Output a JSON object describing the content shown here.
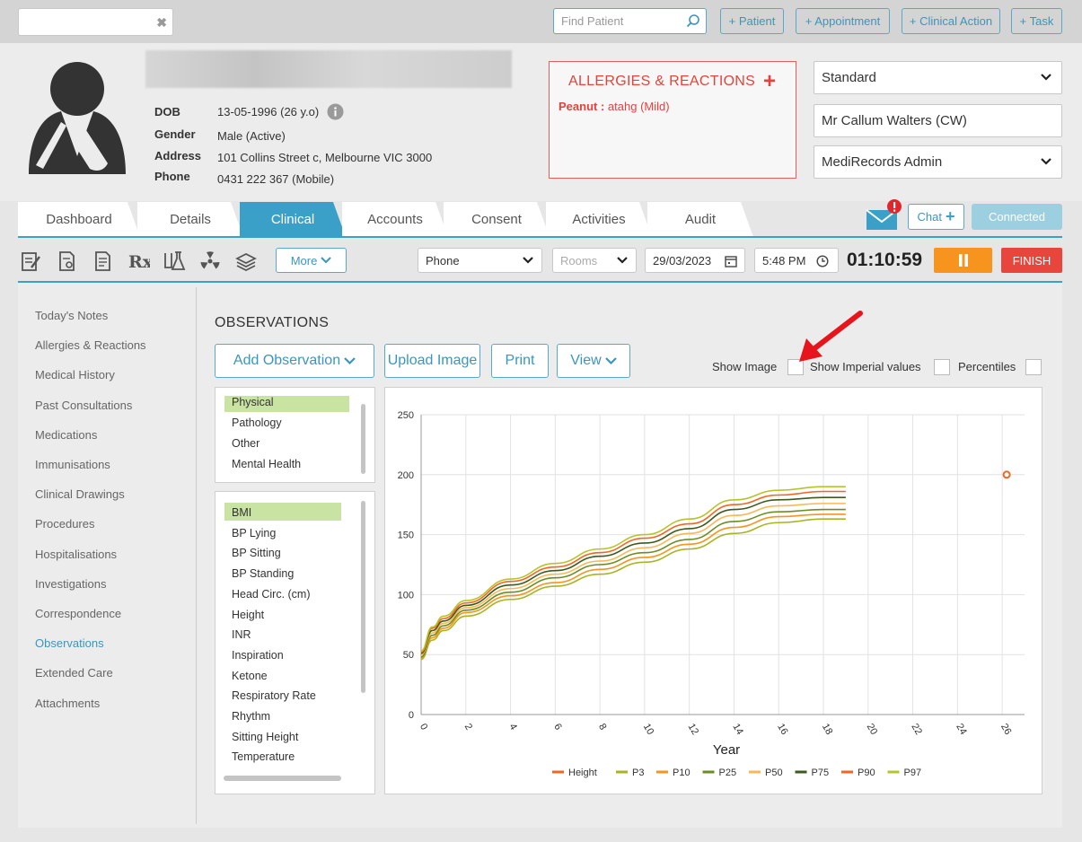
{
  "topbar": {
    "find_patient_placeholder": "Find Patient",
    "buttons": [
      "+ Patient",
      "+ Appointment",
      "+ Clinical Action",
      "+ Task"
    ]
  },
  "patient": {
    "dob_label": "DOB",
    "dob_value": "13-05-1996 (26 y.o)",
    "gender_label": "Gender",
    "gender_value": "Male (Active)",
    "address_label": "Address",
    "address_value": "101 Collins Street c, Melbourne VIC 3000",
    "phone_label": "Phone",
    "phone_value": "0431 222 367 (Mobile)"
  },
  "allergies": {
    "title": "ALLERGIES & REACTIONS",
    "item_name": "Peanut :",
    "item_detail": "atahg (Mild)"
  },
  "right_selects": {
    "template": "Standard",
    "doctor": "Mr Callum Walters (CW)",
    "user": "MediRecords Admin"
  },
  "tabs": [
    "Dashboard",
    "Details",
    "Clinical",
    "Accounts",
    "Consent",
    "Activities",
    "Audit"
  ],
  "active_tab": "Clinical",
  "chat_label": "Chat",
  "connected_label": "Connected",
  "toolbar": {
    "more_label": "More",
    "contact_type": "Phone",
    "rooms_placeholder": "Rooms",
    "date": "29/03/2023",
    "time": "5:48 PM",
    "timer": "01:10:59",
    "finish_label": "FINISH"
  },
  "sidebar": [
    "Today's Notes",
    "Allergies & Reactions",
    "Medical History",
    "Past Consultations",
    "Medications",
    "Immunisations",
    "Clinical Drawings",
    "Procedures",
    "Hospitalisations",
    "Investigations",
    "Correspondence",
    "Observations",
    "Extended Care",
    "Attachments"
  ],
  "sidebar_active": "Observations",
  "observations": {
    "title": "OBSERVATIONS",
    "add_label": "Add Observation",
    "upload_label": "Upload Image",
    "print_label": "Print",
    "view_label": "View",
    "show_image_label": "Show Image",
    "show_imperial_label": "Show Imperial values",
    "percentiles_label": "Percentiles",
    "categories": [
      "Physical",
      "Pathology",
      "Other",
      "Mental Health"
    ],
    "selected_category": "Physical",
    "measures": [
      "BMI",
      "BP Lying",
      "BP Sitting",
      "BP Standing",
      "Head Circ. (cm)",
      "Height",
      "INR",
      "Inspiration",
      "Ketone",
      "Respiratory Rate",
      "Rhythm",
      "Sitting Height",
      "Temperature"
    ],
    "selected_measure": "BMI"
  },
  "chart_data": {
    "type": "line",
    "xlabel": "Year",
    "ylabel": "",
    "xlim": [
      0,
      27
    ],
    "ylim": [
      0,
      250
    ],
    "x_ticks": [
      0,
      2,
      4,
      6,
      8,
      10,
      12,
      14,
      16,
      18,
      20,
      22,
      24,
      26
    ],
    "y_ticks": [
      0,
      50,
      100,
      150,
      200,
      250
    ],
    "grid": true,
    "legend_position": "bottom",
    "x": [
      0,
      0.5,
      1,
      2,
      4,
      6,
      8,
      10,
      12,
      14,
      16,
      18,
      19
    ],
    "series": [
      {
        "name": "Height",
        "type": "scatter",
        "color": "#f26522",
        "points": [
          [
            26.2,
            200
          ]
        ]
      },
      {
        "name": "P3",
        "color": "#a8b521",
        "values": [
          46,
          62,
          70,
          82,
          96,
          107,
          117,
          127,
          138,
          151,
          160,
          163,
          163
        ]
      },
      {
        "name": "P10",
        "color": "#f7941d",
        "values": [
          47,
          64,
          72,
          85,
          99,
          110,
          121,
          131,
          142,
          156,
          165,
          167,
          167
        ]
      },
      {
        "name": "P25",
        "color": "#6b8e23",
        "values": [
          48,
          66,
          74,
          87,
          102,
          114,
          125,
          135,
          146,
          161,
          169,
          171,
          171
        ]
      },
      {
        "name": "P50",
        "color": "#f9b858",
        "values": [
          50,
          68,
          76,
          89,
          105,
          117,
          128,
          139,
          151,
          166,
          174,
          176,
          176
        ]
      },
      {
        "name": "P75",
        "color": "#3d5a1e",
        "values": [
          51,
          70,
          78,
          91,
          108,
          120,
          132,
          143,
          155,
          171,
          179,
          181,
          181
        ]
      },
      {
        "name": "P90",
        "color": "#f26522",
        "values": [
          52,
          72,
          80,
          93,
          111,
          123,
          135,
          147,
          159,
          175,
          183,
          186,
          186
        ]
      },
      {
        "name": "P97",
        "color": "#b5c42a",
        "values": [
          53,
          73,
          82,
          95,
          113,
          126,
          138,
          150,
          163,
          179,
          187,
          190,
          190
        ]
      }
    ]
  }
}
